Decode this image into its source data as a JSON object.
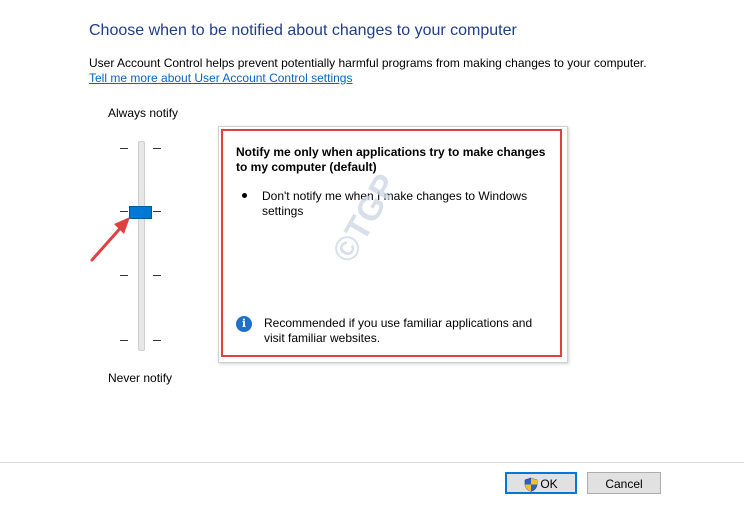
{
  "header": {
    "title": "Choose when to be notified about changes to your computer",
    "description": "User Account Control helps prevent potentially harmful programs from making changes to your computer.",
    "link": "Tell me more about User Account Control settings"
  },
  "slider": {
    "top_label": "Always notify",
    "bottom_label": "Never notify",
    "current_level": 2,
    "levels": 4
  },
  "panel": {
    "title": "Notify me only when applications try to make changes to my computer (default)",
    "bullet": "Don't notify me when I make changes to Windows settings",
    "recommendation": "Recommended if you use familiar applications and visit familiar websites.",
    "info_icon": "i"
  },
  "watermark": "©TGP",
  "buttons": {
    "ok": "OK",
    "cancel": "Cancel"
  },
  "colors": {
    "title": "#1e3e8a",
    "link": "#0066cc",
    "slider_thumb": "#0078d7",
    "highlight": "#e04040",
    "info": "#1e70c8"
  }
}
